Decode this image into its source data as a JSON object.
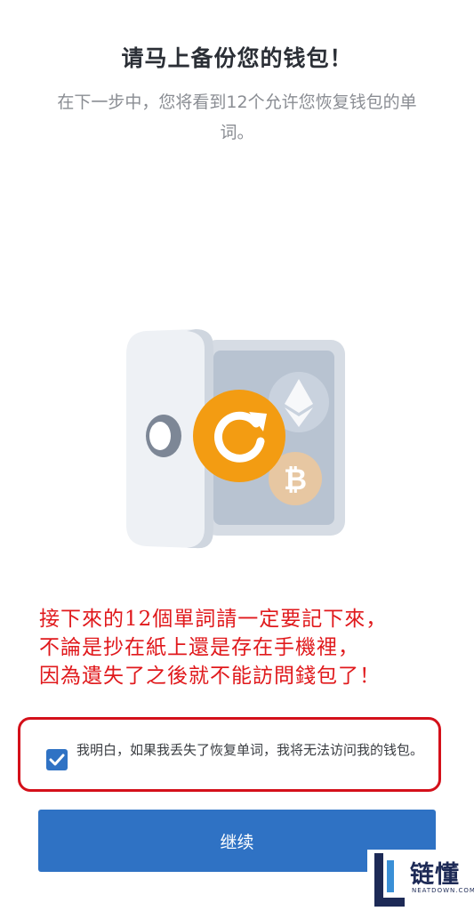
{
  "header": {
    "title": "请马上备份您的钱包！",
    "subtitle": "在下一步中，您将看到12个允许您恢复钱包的单词。"
  },
  "illustration": {
    "icon": "vault-backup-icon",
    "accent_color": "#F39C12"
  },
  "warning": {
    "lines": [
      "接下來的12個單詞請一定要記下來，",
      "不論是抄在紙上還是存在手機裡，",
      "因為遺失了之後就不能訪問錢包了！"
    ],
    "color": "#E0191C"
  },
  "acknowledge": {
    "checked": true,
    "text": "我明白，如果我丢失了恢复单词，我将无法访问我的钱包。"
  },
  "continue_button": {
    "label": "继续",
    "color": "#2F72C4"
  },
  "watermark": {
    "name": "链懂",
    "site": "NEATDOWN.COM"
  }
}
